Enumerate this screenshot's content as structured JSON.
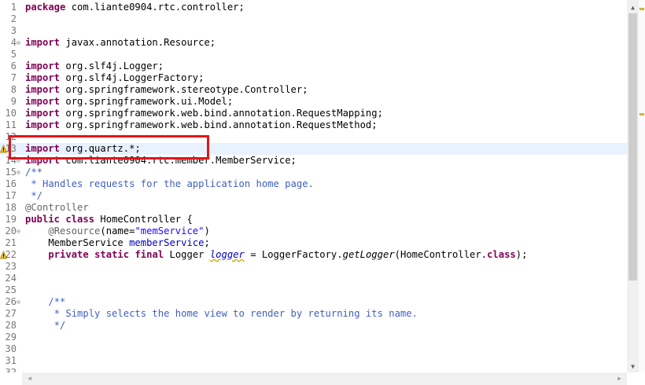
{
  "editor": {
    "lines": [
      {
        "n": "1",
        "html": "<span class=\"kw\">package</span> com.liante0904.rtc.controller;"
      },
      {
        "n": "2",
        "html": ""
      },
      {
        "n": "3",
        "html": ""
      },
      {
        "n": "4",
        "fold": "true",
        "html": "<span class=\"kw\">import</span> javax.annotation.Resource;"
      },
      {
        "n": "5",
        "html": ""
      },
      {
        "n": "6",
        "html": "<span class=\"kw\">import</span> org.slf4j.Logger;"
      },
      {
        "n": "7",
        "html": "<span class=\"kw\">import</span> org.slf4j.LoggerFactory;"
      },
      {
        "n": "8",
        "html": "<span class=\"kw\">import</span> org.springframework.stereotype.Controller;"
      },
      {
        "n": "9",
        "html": "<span class=\"kw\">import</span> org.springframework.ui.Model;"
      },
      {
        "n": "10",
        "html": "<span class=\"kw\">import</span> org.springframework.web.bind.annotation.RequestMapping;"
      },
      {
        "n": "11",
        "html": "<span class=\"kw\">import</span> org.springframework.web.bind.annotation.RequestMethod;"
      },
      {
        "n": "12",
        "html": ""
      },
      {
        "n": "13",
        "warn": "true",
        "current": "true",
        "html": "<span class=\"kw\">import</span> org.quartz.*;"
      },
      {
        "n": "14",
        "fold": "true",
        "html": "<span class=\"kw\">import</span> com.liante0904.rtc.member.MemberService;"
      },
      {
        "n": "15",
        "fold": "true",
        "html": "<span class=\"cm\">/**</span>"
      },
      {
        "n": "16",
        "html": "<span class=\"cm\"> * Handles requests for the application home page.</span>"
      },
      {
        "n": "17",
        "html": "<span class=\"cm\"> */</span>"
      },
      {
        "n": "18",
        "html": "<span class=\"ann\">@Controller</span>"
      },
      {
        "n": "19",
        "html": "<span class=\"kw\">public</span> <span class=\"kw\">class</span> HomeController {"
      },
      {
        "n": "20",
        "fold": "true",
        "html": "    <span class=\"ann\">@Resource</span>(name=<span class=\"str\">\"memService\"</span>)"
      },
      {
        "n": "21",
        "html": "    MemberService <span class=\"fld\">memberService</span>;"
      },
      {
        "n": "22",
        "warn": "true",
        "html": "    <span class=\"kw\">private</span> <span class=\"kw\">static</span> <span class=\"kw\">final</span> Logger <span class=\"sfld warnline\">logger</span> = LoggerFactory.<span class=\"ita\">getLogger</span>(HomeController.<span class=\"kw\">class</span>);"
      },
      {
        "n": "23",
        "html": ""
      },
      {
        "n": "24",
        "html": ""
      },
      {
        "n": "25",
        "html": ""
      },
      {
        "n": "26",
        "fold": "true",
        "html": "    <span class=\"cm\">/**</span>"
      },
      {
        "n": "27",
        "html": "<span class=\"cm\">     * Simply selects the home view to render by returning its name.</span>"
      },
      {
        "n": "28",
        "html": "<span class=\"cm\">     */</span>"
      },
      {
        "n": "29",
        "html": ""
      },
      {
        "n": "30",
        "html": ""
      },
      {
        "n": "31",
        "html": ""
      },
      {
        "n": "32",
        "html": ""
      }
    ]
  },
  "scrollbar": {
    "up_icon": "scroll-up-arrow",
    "down_icon": "scroll-down-arrow",
    "left_icon": "scroll-left-arrow",
    "right_icon": "scroll-right-arrow"
  },
  "colors": {
    "keyword": "#7f0055",
    "comment": "#3f5fbf",
    "string": "#2a00ff",
    "field": "#0000c0",
    "highlight_box": "#e3151a",
    "current_line": "#e8f2fe"
  }
}
